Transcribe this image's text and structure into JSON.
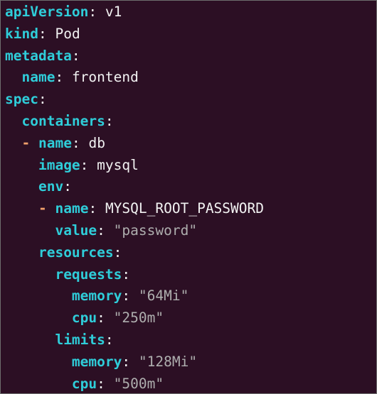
{
  "code": {
    "apiVersion_key": "apiVersion",
    "apiVersion_value": "v1",
    "kind_key": "kind",
    "kind_value": "Pod",
    "metadata_key": "metadata",
    "metadata_name_key": "name",
    "metadata_name_value": "frontend",
    "spec_key": "spec",
    "containers_key": "containers",
    "dash": "-",
    "container_name_key": "name",
    "container_name_value": "db",
    "image_key": "image",
    "image_value": "mysql",
    "env_key": "env",
    "env_name_key": "name",
    "env_name_value": "MYSQL_ROOT_PASSWORD",
    "env_value_key": "value",
    "env_value_value": "\"password\"",
    "resources_key": "resources",
    "requests_key": "requests",
    "requests_memory_key": "memory",
    "requests_memory_value": "\"64Mi\"",
    "requests_cpu_key": "cpu",
    "requests_cpu_value": "\"250m\"",
    "limits_key": "limits",
    "limits_memory_key": "memory",
    "limits_memory_value": "\"128Mi\"",
    "limits_cpu_key": "cpu",
    "limits_cpu_value": "\"500m\"",
    "colon": ":"
  },
  "colors": {
    "background": "#2c0f24",
    "key": "#2fcdd9",
    "plain": "#f2f2f2",
    "string": "#aeaeae",
    "dash": "#f1a06b"
  }
}
